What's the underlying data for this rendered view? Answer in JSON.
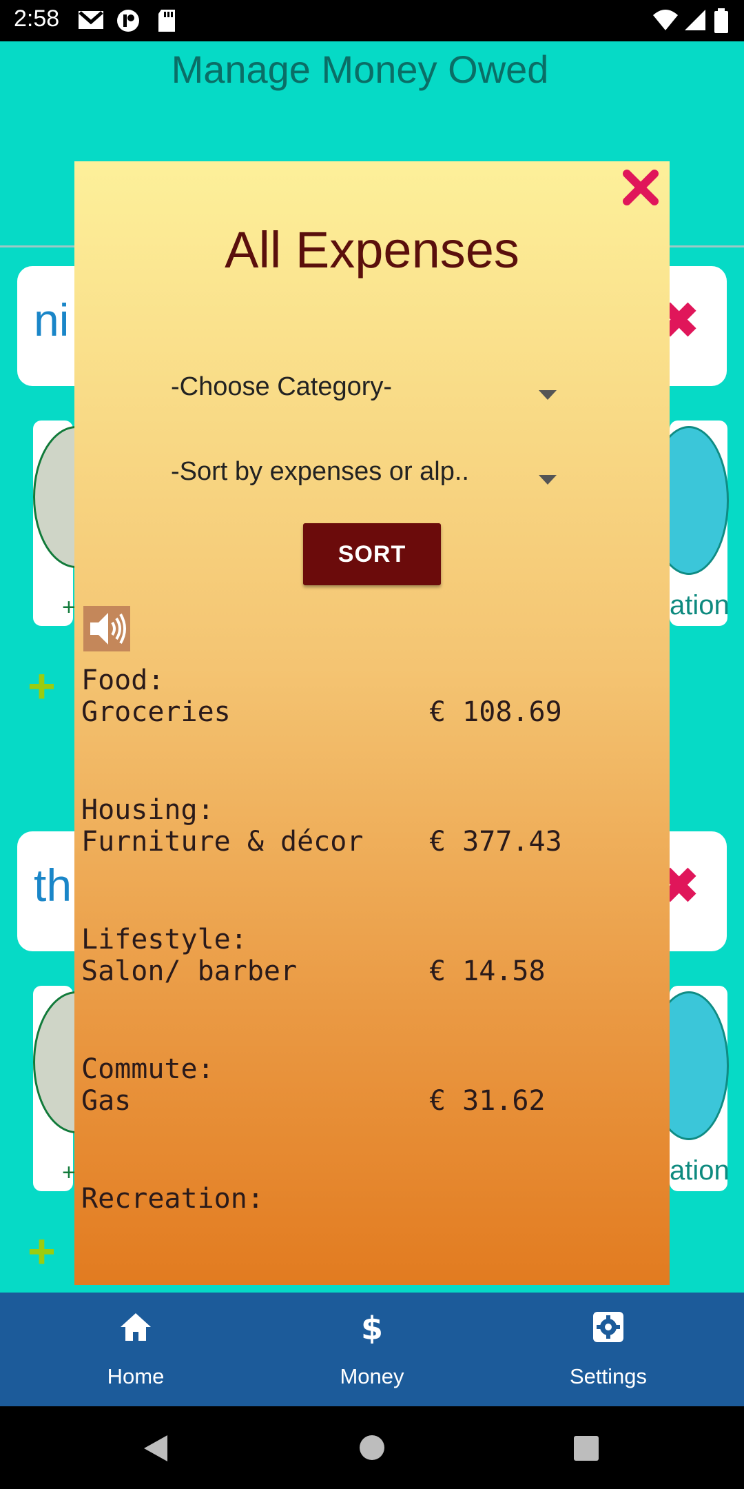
{
  "status_bar": {
    "time": "2:58"
  },
  "app": {
    "title": "Manage Money Owed"
  },
  "background": {
    "card1_name": "ni",
    "card2_name": "th",
    "ation_label": "ation",
    "plus": "+"
  },
  "modal": {
    "title": "All Expenses",
    "category_select": "-Choose Category-",
    "sort_select": "-Sort by expenses or alp..",
    "sort_button": "SORT",
    "expenses": [
      {
        "category": "Food:",
        "item": "Groceries",
        "amount": "€ 108.69"
      },
      {
        "category": "Housing:",
        "item": "Furniture & décor",
        "amount": "€ 377.43"
      },
      {
        "category": "Lifestyle:",
        "item": "Salon/ barber",
        "amount": "€ 14.58"
      },
      {
        "category": "Commute:",
        "item": "Gas",
        "amount": "€ 31.62"
      },
      {
        "category": "Recreation:",
        "item": "",
        "amount": ""
      }
    ]
  },
  "bottom_nav": {
    "home": "Home",
    "money": "Money",
    "settings": "Settings"
  },
  "colors": {
    "background": "#06dac6",
    "modal_title": "#5a0f0c",
    "sort_button": "#6b0b0b",
    "nav": "#1c5b9a",
    "close": "#e0165a"
  }
}
